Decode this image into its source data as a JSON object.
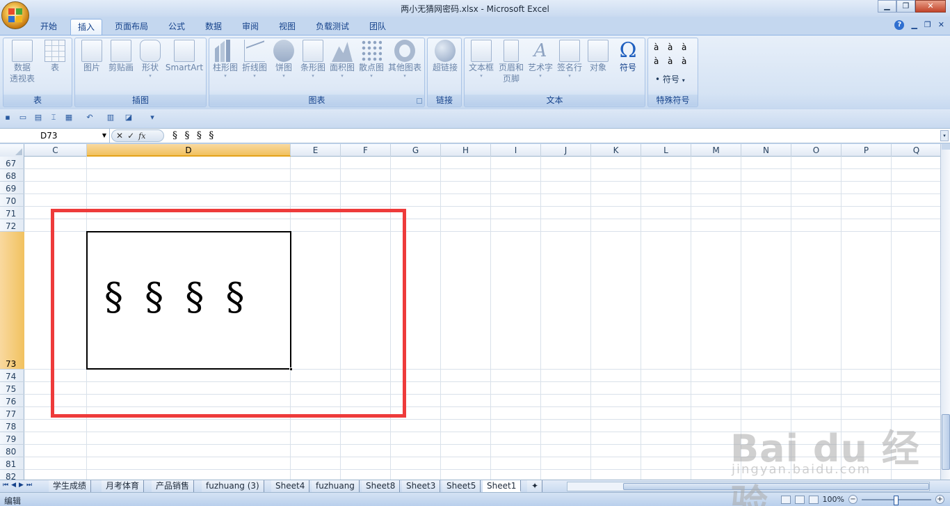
{
  "window": {
    "title": "两小无猜网密码.xlsx - Microsoft Excel",
    "controls": [
      "minimize",
      "maximize",
      "close"
    ]
  },
  "tabs": [
    {
      "label": "开始",
      "active": false
    },
    {
      "label": "插入",
      "active": true
    },
    {
      "label": "页面布局",
      "active": false
    },
    {
      "label": "公式",
      "active": false
    },
    {
      "label": "数据",
      "active": false
    },
    {
      "label": "审阅",
      "active": false
    },
    {
      "label": "视图",
      "active": false
    },
    {
      "label": "负载测试",
      "active": false
    },
    {
      "label": "团队",
      "active": false
    }
  ],
  "ribbon": {
    "groups": {
      "table": {
        "label": "表",
        "buttons": [
          {
            "line1": "数据",
            "line2": "透视表",
            "icon": "pivot-table-icon"
          },
          {
            "line1": "表",
            "line2": "",
            "icon": "table-icon"
          }
        ]
      },
      "illustrations": {
        "label": "插图",
        "buttons": [
          {
            "line1": "图片",
            "icon": "picture-icon"
          },
          {
            "line1": "剪贴画",
            "icon": "clip-art-icon"
          },
          {
            "line1": "形状",
            "icon": "shapes-icon"
          },
          {
            "line1": "SmartArt",
            "icon": "smartart-icon"
          }
        ]
      },
      "charts": {
        "label": "图表",
        "buttons": [
          {
            "line1": "柱形图",
            "icon": "column-chart-icon"
          },
          {
            "line1": "折线图",
            "icon": "line-chart-icon"
          },
          {
            "line1": "饼图",
            "icon": "pie-chart-icon"
          },
          {
            "line1": "条形图",
            "icon": "bar-chart-icon"
          },
          {
            "line1": "面积图",
            "icon": "area-chart-icon"
          },
          {
            "line1": "散点图",
            "icon": "scatter-chart-icon"
          },
          {
            "line1": "其他图表",
            "icon": "other-charts-icon"
          }
        ]
      },
      "links": {
        "label": "链接",
        "buttons": [
          {
            "line1": "超链接",
            "icon": "hyperlink-icon"
          }
        ]
      },
      "text": {
        "label": "文本",
        "buttons": [
          {
            "line1": "文本框",
            "icon": "text-box-icon"
          },
          {
            "line1": "页眉和",
            "line2": "页脚",
            "icon": "header-footer-icon"
          },
          {
            "line1": "艺术字",
            "icon": "wordart-icon"
          },
          {
            "line1": "签名行",
            "icon": "signature-line-icon"
          },
          {
            "line1": "对象",
            "icon": "object-icon"
          },
          {
            "line1": "符号",
            "icon": "omega-icon"
          }
        ]
      },
      "special_symbols": {
        "label": "特殊符号",
        "glyph": "à",
        "button_label": "符号"
      }
    }
  },
  "formula_bar": {
    "name_box": "D73",
    "fx_label": "fx",
    "content": "§ § § §"
  },
  "grid": {
    "columns": [
      "C",
      "D",
      "E",
      "F",
      "G",
      "H",
      "I",
      "J",
      "K",
      "L",
      "M",
      "N",
      "O",
      "P",
      "Q"
    ],
    "selected_column": "D",
    "rows": [
      "67",
      "68",
      "69",
      "70",
      "71",
      "72",
      "73",
      "74",
      "75",
      "76",
      "77",
      "78",
      "79",
      "80",
      "81",
      "82"
    ],
    "selected_row": "73",
    "active_cell_text": "§ § § §"
  },
  "sheet_tabs": [
    {
      "label": "学生成绩",
      "active": false
    },
    {
      "label": "月考体育",
      "active": false
    },
    {
      "label": "产品销售",
      "active": false
    },
    {
      "label": "fuzhuang (3)",
      "active": false
    },
    {
      "label": "Sheet4",
      "active": false
    },
    {
      "label": "fuzhuang",
      "active": false
    },
    {
      "label": "Sheet8",
      "active": false
    },
    {
      "label": "Sheet3",
      "active": false
    },
    {
      "label": "Sheet5",
      "active": false
    },
    {
      "label": "Sheet1",
      "active": true
    }
  ],
  "status_bar": {
    "mode": "编辑",
    "zoom": "100%"
  },
  "watermark": {
    "main": "Bai du 经验",
    "sub": "jingyan.baidu.com"
  },
  "colors": {
    "highlight": "#ee3b3b",
    "selected_header": "#f1c15f",
    "ribbon_text": "#15428b"
  }
}
